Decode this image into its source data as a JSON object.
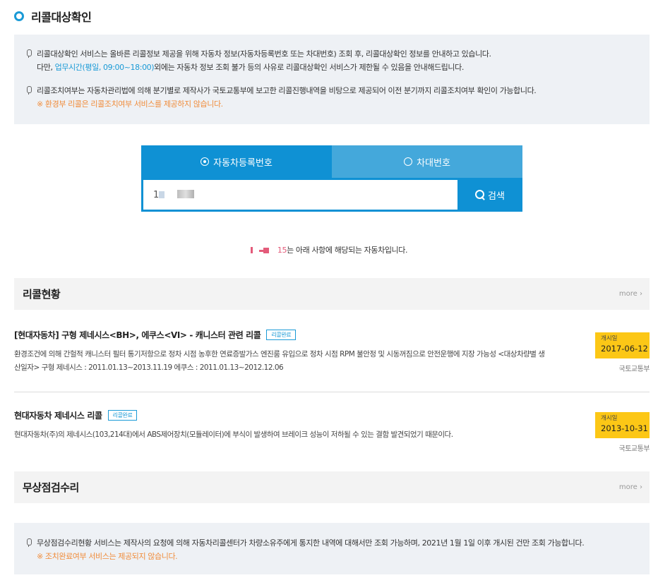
{
  "page": {
    "title": "리콜대상확인"
  },
  "notice": {
    "line1": "리콜대상확인 서비스는 올바른 리콜정보 제공을 위해 자동차 정보(자동차등록번호 또는 차대번호) 조회 후, 리콜대상확인 정보를 안내하고 있습니다.",
    "line2_pre": "다만, ",
    "line2_hours": "업무시간(평일, 09:00~18:00)",
    "line2_post": "외에는 자동차 정보 조회 불가 등의 사유로 리콜대상확인 서비스가 제한될 수 있음을 안내해드립니다.",
    "line3": "리콜조치여부는 자동차관리법에 의해 분기별로 제작사가 국토교통부에 보고한 리콜진행내역을 비탕으로 제공되어 이전 분기까지 리콜조치여부 확인이 가능합니다.",
    "line4": "※ 환경부 리콜은 리콜조치여부 서비스를 제공하지 않습니다."
  },
  "search": {
    "tab_registration": "자동차등록번호",
    "tab_chassis": "차대번호",
    "selected_tab": "자동차등록번호",
    "input_value": "1",
    "button_label": "검색"
  },
  "result": {
    "plate_suffix": "15",
    "message": "는 아래 사항에 해당되는 자동차입니다."
  },
  "recall_section": {
    "title": "리콜현황",
    "more": "more ›",
    "items": [
      {
        "title": "[현대자동차] 구형 제네시스<BH>, 에쿠스<VI> - 캐니스터 관련 리콜",
        "badge": "리콜완료",
        "description": "환경조건에 의해 간헐적 캐니스터 필터 통기저항으로 정차 시점 농후한 연료증발가스 엔진룸 유입으로 정차 시점 RPM 불안정 및 시동꺼짐으로 안전운행에 지장 가능성 <대상차량별 생산일자> 구형 제네시스 : 2011.01.13~2013.11.19 에쿠스 : 2011.01.13~2012.12.06",
        "date_label": "개시일",
        "date": "2017-06-12",
        "agency": "국토교통부"
      },
      {
        "title": "현대자동차 제네시스 리콜",
        "badge": "리콜완료",
        "description": "현대자동차(주)의 제네시스(103,214대)에서 ABS제어장치(모듈레이터)에 부식이 발생하여 브레이크 성능이 저하될 수 있는 결함 발견되었기 때문이다.",
        "date_label": "개시일",
        "date": "2013-10-31",
        "agency": "국토교통부"
      }
    ]
  },
  "free_repair_section": {
    "title": "무상점검수리",
    "more": "more ›",
    "notice_line1": "무상점검수리현황 서비스는 제작사의 요청에 의해 자동차리콜센터가 차량소유주에게 통지한 내역에 대해서만 조회 가능하며, 2021년 1월 1일 이후 개시된 건만 조회 가능합니다.",
    "notice_line2": "※ 조치완료여부 서비스는 제공되지 않습니다."
  },
  "colors": {
    "primary": "#0f91d4",
    "tab_inactive": "#44a8db",
    "info_bg": "#eef1f5",
    "warning": "#f08c3a",
    "date_bg": "#fcc716"
  }
}
